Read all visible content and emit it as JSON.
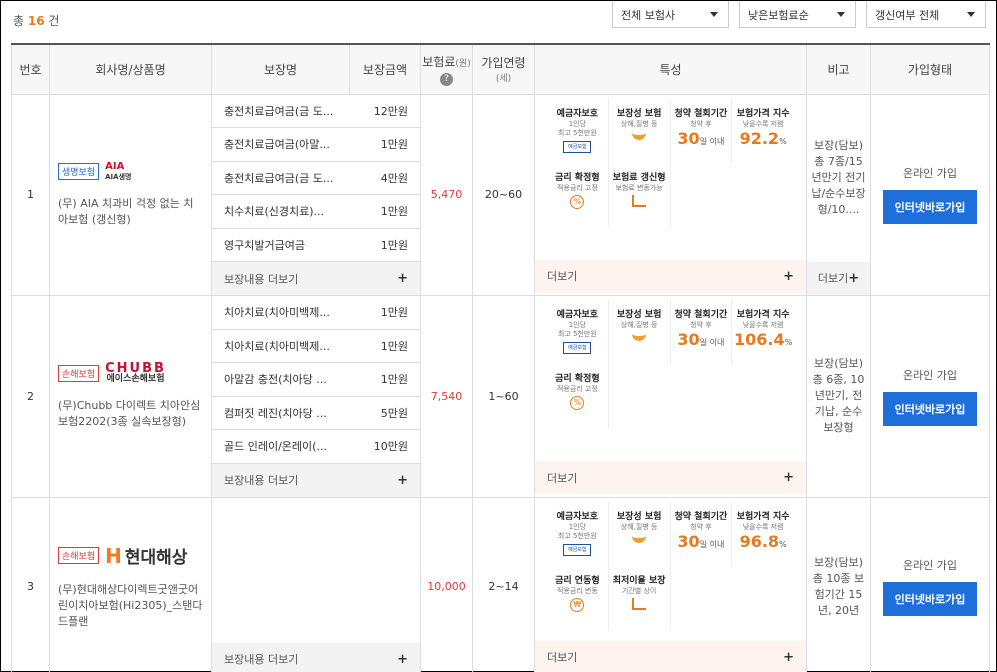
{
  "summary": {
    "prefix": "총",
    "count": "16",
    "suffix": "건"
  },
  "filters": [
    {
      "value": "전체 보험사"
    },
    {
      "value": "낮은보험료순"
    },
    {
      "value": "갱신여부 전체"
    }
  ],
  "headers": {
    "no": "번호",
    "company": "회사명/상품명",
    "coverage": "보장명",
    "coverage_amount": "보장금액",
    "premium": "보험료",
    "premium_unit": "(원)",
    "age": "가입연령",
    "age_unit": "(세)",
    "features": "특성",
    "remark": "비고",
    "join_type": "가입형태"
  },
  "more_coverage_label": "보장내용 더보기",
  "more_label": "더보기",
  "products": [
    {
      "no": "1",
      "type_badge": "생명보험",
      "logo_name": "aia-logo",
      "logo_text": "AIA",
      "logo_sub": "AIA생명",
      "name": "(무) AIA 치과비 걱정 없는 치아보험 (갱신형)",
      "coverages": [
        {
          "name": "충전치료급여금(금 도...",
          "amount": "12만원"
        },
        {
          "name": "충전치료급여금(아말...",
          "amount": "1만원"
        },
        {
          "name": "충전치료급여금(금 도...",
          "amount": "4만원"
        },
        {
          "name": "치수치료(신경치료)...",
          "amount": "1만원"
        },
        {
          "name": "영구치발거급여금",
          "amount": "1만원"
        }
      ],
      "premium": "5,470",
      "age": "20~60",
      "features": [
        {
          "title": "예금자보호",
          "sub1": "1인당",
          "sub2": "최고 5천만원",
          "icon": "deposit-icon"
        },
        {
          "title": "보장성 보험",
          "sub1": "상해,질병 등",
          "icon": "bowl-icon"
        },
        {
          "title": "청약 철회기간",
          "sub1": "청약 후",
          "value": "30",
          "unit": "일 이내"
        },
        {
          "title": "보험가격 지수",
          "sub1": "낮을수록 저렴",
          "value": "92.2",
          "unit": "%"
        },
        {
          "title": "금리 확정형",
          "sub1": "적용금리 고정",
          "icon": "percent-icon"
        },
        {
          "title": "보험료 갱신형",
          "sub1": "보험료 변동가능",
          "icon": "chart-icon"
        }
      ],
      "remark": "보장(담보) 총 7종/15년만기 전기납/순수보장형/10....",
      "remark_more": "더보기",
      "join_label": "온라인 가입",
      "join_button": "인터넷바로가입"
    },
    {
      "no": "2",
      "type_badge": "손해보험",
      "logo_name": "chubb-logo",
      "logo_text": "CHUBB",
      "logo_sub": "에이스손해보험",
      "name": "(무)Chubb 다이렉트 치아안심보험2202(3종 실속보장형)",
      "coverages": [
        {
          "name": "치아치료(치아미백제...",
          "amount": "1만원"
        },
        {
          "name": "치아치료(치아미백제...",
          "amount": "1만원"
        },
        {
          "name": "아말감 충전(치아당 ...",
          "amount": "1만원"
        },
        {
          "name": "컴퍼짓 레진(치아당 ...",
          "amount": "5만원"
        },
        {
          "name": "골드 인레이/온레이(...",
          "amount": "10만원"
        }
      ],
      "premium": "7,540",
      "age": "1~60",
      "features": [
        {
          "title": "예금자보호",
          "sub1": "1인당",
          "sub2": "최고 5천만원",
          "icon": "deposit-icon"
        },
        {
          "title": "보장성 보험",
          "sub1": "상해,질병 등",
          "icon": "bowl-icon"
        },
        {
          "title": "청약 철회기간",
          "sub1": "청약 후",
          "value": "30",
          "unit": "일 이내"
        },
        {
          "title": "보험가격 지수",
          "sub1": "낮을수록 저렴",
          "value": "106.4",
          "unit": "%"
        },
        {
          "title": "금리 확정형",
          "sub1": "적용금리 고정",
          "icon": "percent-icon"
        }
      ],
      "remark": "보장(담보) 총 6종, 10년만기, 전기납, 순수보장형",
      "join_label": "온라인 가입",
      "join_button": "인터넷바로가입"
    },
    {
      "no": "3",
      "type_badge": "손해보험",
      "logo_name": "hyundai-logo",
      "logo_text": "현대해상",
      "logo_sub": "H",
      "name": "(무)현대해상다이렉트굿앤굿어린이치아보험(Hi2305)_스탠다드플랜",
      "coverages": [],
      "premium": "10,000",
      "age": "2~14",
      "features": [
        {
          "title": "예금자보호",
          "sub1": "1인당",
          "sub2": "최고 5천만원",
          "icon": "deposit-icon"
        },
        {
          "title": "보장성 보험",
          "sub1": "상해,질병 등",
          "icon": "bowl-icon"
        },
        {
          "title": "청약 철회기간",
          "sub1": "청약 후",
          "value": "30",
          "unit": "일 이내"
        },
        {
          "title": "보험가격 지수",
          "sub1": "낮을수록 저렴",
          "value": "96.8",
          "unit": "%"
        },
        {
          "title": "금리 연동형",
          "sub1": "적용금리 변동",
          "icon": "won-icon"
        },
        {
          "title": "최저이율 보장",
          "sub1": "기간별 상이",
          "icon": "chart-icon"
        }
      ],
      "remark": "보장(담보) 총 10종 보험기간 15년, 20년",
      "join_label": "온라인 가입",
      "join_button": "인터넷바로가입"
    }
  ]
}
